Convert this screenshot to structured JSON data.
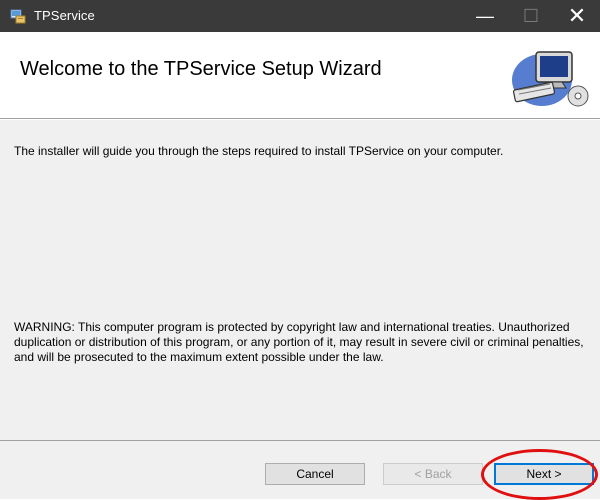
{
  "window": {
    "title": "TPService",
    "minimize_glyph": "—",
    "maximize_glyph": "☐",
    "close_glyph": "✕"
  },
  "header": {
    "title": "Welcome to the TPService Setup Wizard",
    "art_icon": "computer-setup-icon"
  },
  "body": {
    "intro": "The installer will guide you through the steps required to install TPService on your computer.",
    "warning": "WARNING: This computer program is protected by copyright law and international treaties. Unauthorized duplication or distribution of this program, or any portion of it, may result in severe civil or criminal penalties, and will be prosecuted to the maximum extent possible under the law."
  },
  "buttons": {
    "cancel": "Cancel",
    "back": "< Back",
    "next": "Next >"
  },
  "colors": {
    "titlebar": "#3a3a3a",
    "body_bg": "#f0f0f0",
    "accent": "#0078d7",
    "highlight_circle": "#e01010"
  }
}
